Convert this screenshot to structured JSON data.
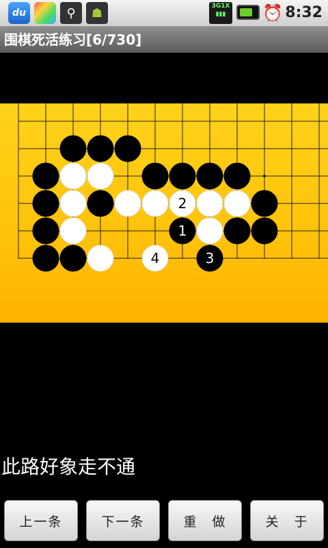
{
  "status_bar": {
    "time": "8:32",
    "icons": [
      "du-icon",
      "app-icon",
      "usb-icon",
      "android-debug-icon",
      "signal-icon",
      "battery-icon",
      "alarm-icon"
    ],
    "du_label": "du",
    "signal_label": "3G1X"
  },
  "title": "围棋死活练习[6/730]",
  "message": "此路好象走不通",
  "buttons": {
    "prev": "上一条",
    "next": "下一条",
    "redo": "重　做",
    "about": "关　于"
  },
  "board": {
    "background_color": "#ffc20a",
    "stones": [
      {
        "color": "black",
        "col": 2,
        "row": 1
      },
      {
        "color": "black",
        "col": 3,
        "row": 1
      },
      {
        "color": "black",
        "col": 4,
        "row": 1
      },
      {
        "color": "black",
        "col": 1,
        "row": 2
      },
      {
        "color": "white",
        "col": 2,
        "row": 2
      },
      {
        "color": "white",
        "col": 3,
        "row": 2
      },
      {
        "color": "black",
        "col": 5,
        "row": 2
      },
      {
        "color": "black",
        "col": 6,
        "row": 2
      },
      {
        "color": "black",
        "col": 7,
        "row": 2
      },
      {
        "color": "black",
        "col": 8,
        "row": 2
      },
      {
        "color": "black",
        "col": 1,
        "row": 3
      },
      {
        "color": "white",
        "col": 2,
        "row": 3
      },
      {
        "color": "black",
        "col": 3,
        "row": 3
      },
      {
        "color": "white",
        "col": 4,
        "row": 3
      },
      {
        "color": "white",
        "col": 5,
        "row": 3
      },
      {
        "color": "white",
        "col": 6,
        "row": 3,
        "label": "2"
      },
      {
        "color": "white",
        "col": 7,
        "row": 3
      },
      {
        "color": "white",
        "col": 8,
        "row": 3
      },
      {
        "color": "black",
        "col": 9,
        "row": 3
      },
      {
        "color": "black",
        "col": 1,
        "row": 4
      },
      {
        "color": "white",
        "col": 2,
        "row": 4
      },
      {
        "color": "black",
        "col": 6,
        "row": 4,
        "label": "1"
      },
      {
        "color": "white",
        "col": 7,
        "row": 4
      },
      {
        "color": "black",
        "col": 8,
        "row": 4
      },
      {
        "color": "black",
        "col": 9,
        "row": 4
      },
      {
        "color": "black",
        "col": 1,
        "row": 5
      },
      {
        "color": "black",
        "col": 2,
        "row": 5
      },
      {
        "color": "white",
        "col": 3,
        "row": 5
      },
      {
        "color": "white",
        "col": 5,
        "row": 5,
        "label": "4"
      },
      {
        "color": "black",
        "col": 7,
        "row": 5,
        "label": "3"
      }
    ]
  }
}
